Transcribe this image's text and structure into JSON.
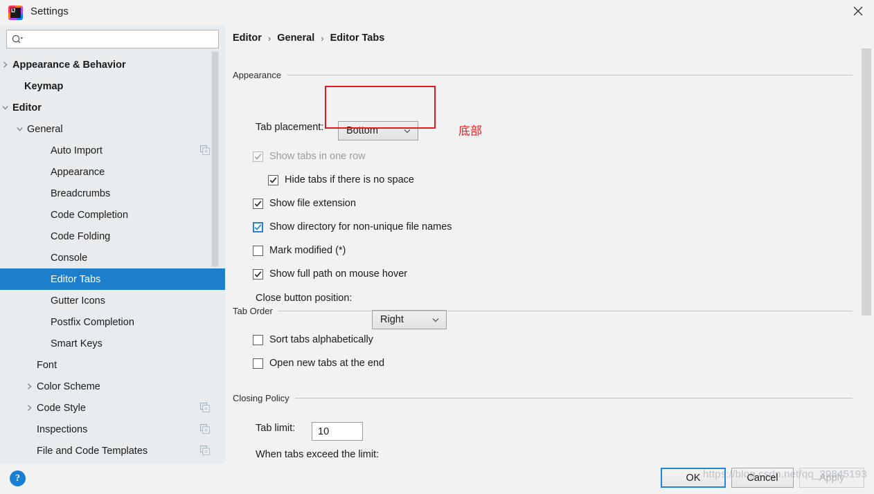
{
  "window": {
    "title": "Settings",
    "logo_icon": "intellij-idea-logo",
    "close_icon": "close-icon"
  },
  "sidebar": {
    "search": {
      "placeholder": "",
      "value": "",
      "icon": "search-icon"
    },
    "items": [
      {
        "label": "Appearance & Behavior",
        "indent": 18,
        "arrow": "chevron-right",
        "bold": true,
        "copy": false,
        "selected": false
      },
      {
        "label": "Keymap",
        "indent": 35,
        "arrow": "none",
        "bold": true,
        "copy": false,
        "selected": false
      },
      {
        "label": "Editor",
        "indent": 18,
        "arrow": "chevron-down",
        "bold": true,
        "copy": false,
        "selected": false
      },
      {
        "label": "General",
        "indent": 39,
        "arrow": "chevron-down",
        "bold": false,
        "copy": false,
        "selected": false
      },
      {
        "label": "Auto Import",
        "indent": 73,
        "arrow": "none",
        "bold": false,
        "copy": true,
        "selected": false
      },
      {
        "label": "Appearance",
        "indent": 73,
        "arrow": "none",
        "bold": false,
        "copy": false,
        "selected": false
      },
      {
        "label": "Breadcrumbs",
        "indent": 73,
        "arrow": "none",
        "bold": false,
        "copy": false,
        "selected": false
      },
      {
        "label": "Code Completion",
        "indent": 73,
        "arrow": "none",
        "bold": false,
        "copy": false,
        "selected": false
      },
      {
        "label": "Code Folding",
        "indent": 73,
        "arrow": "none",
        "bold": false,
        "copy": false,
        "selected": false
      },
      {
        "label": "Console",
        "indent": 73,
        "arrow": "none",
        "bold": false,
        "copy": false,
        "selected": false
      },
      {
        "label": "Editor Tabs",
        "indent": 73,
        "arrow": "none",
        "bold": false,
        "copy": false,
        "selected": true
      },
      {
        "label": "Gutter Icons",
        "indent": 73,
        "arrow": "none",
        "bold": false,
        "copy": false,
        "selected": false
      },
      {
        "label": "Postfix Completion",
        "indent": 73,
        "arrow": "none",
        "bold": false,
        "copy": false,
        "selected": false
      },
      {
        "label": "Smart Keys",
        "indent": 73,
        "arrow": "none",
        "bold": false,
        "copy": false,
        "selected": false
      },
      {
        "label": "Font",
        "indent": 53,
        "arrow": "none",
        "bold": false,
        "copy": false,
        "selected": false
      },
      {
        "label": "Color Scheme",
        "indent": 53,
        "arrow": "chevron-right",
        "bold": false,
        "copy": false,
        "selected": false
      },
      {
        "label": "Code Style",
        "indent": 53,
        "arrow": "chevron-right",
        "bold": false,
        "copy": true,
        "selected": false
      },
      {
        "label": "Inspections",
        "indent": 53,
        "arrow": "none",
        "bold": false,
        "copy": true,
        "selected": false
      },
      {
        "label": "File and Code Templates",
        "indent": 53,
        "arrow": "none",
        "bold": false,
        "copy": true,
        "selected": false
      }
    ]
  },
  "breadcrumb": {
    "parts": [
      "Editor",
      "General",
      "Editor Tabs"
    ],
    "separator": "›"
  },
  "sections": {
    "appearance": {
      "title": "Appearance",
      "tab_placement": {
        "label": "Tab placement:",
        "value": "Bottom",
        "caret_icon": "chevron-down-icon"
      },
      "checkboxes": [
        {
          "label": "Show tabs in one row",
          "checked": true,
          "disabled": true,
          "focused": false,
          "indent": 40
        },
        {
          "label": "Hide tabs if there is no space",
          "checked": true,
          "disabled": false,
          "focused": false,
          "indent": 62
        },
        {
          "label": "Show file extension",
          "checked": true,
          "disabled": false,
          "focused": false,
          "indent": 40
        },
        {
          "label": "Show directory for non-unique file names",
          "checked": true,
          "disabled": false,
          "focused": true,
          "indent": 40
        },
        {
          "label": "Mark modified (*)",
          "checked": false,
          "disabled": false,
          "focused": false,
          "indent": 40
        },
        {
          "label": "Show full path on mouse hover",
          "checked": true,
          "disabled": false,
          "focused": false,
          "indent": 40
        }
      ],
      "close_button_position": {
        "label": "Close button position:",
        "value": "Right",
        "caret_icon": "chevron-down-icon"
      }
    },
    "tab_order": {
      "title": "Tab Order",
      "checkboxes": [
        {
          "label": "Sort tabs alphabetically",
          "checked": false
        },
        {
          "label": "Open new tabs at the end",
          "checked": false
        }
      ]
    },
    "closing_policy": {
      "title": "Closing Policy",
      "tab_limit": {
        "label": "Tab limit:",
        "value": "10"
      },
      "when_exceed_label": "When tabs exceed the limit:"
    }
  },
  "annotation": {
    "text": "底部",
    "box_color": "#e01b1b",
    "text_color": "#ee2222"
  },
  "footer": {
    "help_icon": "help-question-icon",
    "help_glyph": "?",
    "ok_label": "OK",
    "cancel_label": "Cancel",
    "apply_label": "Apply"
  },
  "watermark": {
    "text": "https://blog.csdn.net/qq_39845193"
  }
}
